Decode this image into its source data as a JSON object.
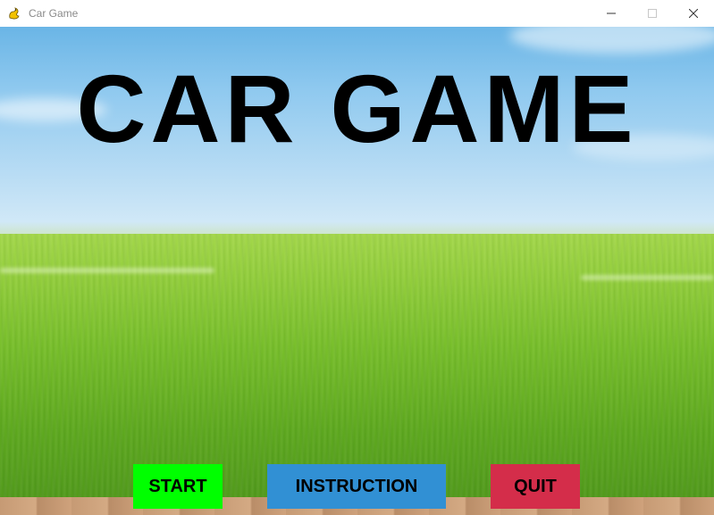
{
  "window": {
    "title": "Car Game",
    "app_icon": "pygame-snake-icon",
    "controls": [
      "minimize-icon",
      "maximize-icon",
      "close-icon"
    ]
  },
  "game": {
    "title": "CAR GAME",
    "buttons": {
      "start": "START",
      "instruction": "INSTRUCTION",
      "quit": "QUIT"
    },
    "colors": {
      "title": "#000000",
      "start_button": "#00ff00",
      "instruction_button": "#3190d4",
      "quit_button": "#d42d4a",
      "sky": "#8fc9ef",
      "grass": "#78bf2a"
    }
  }
}
